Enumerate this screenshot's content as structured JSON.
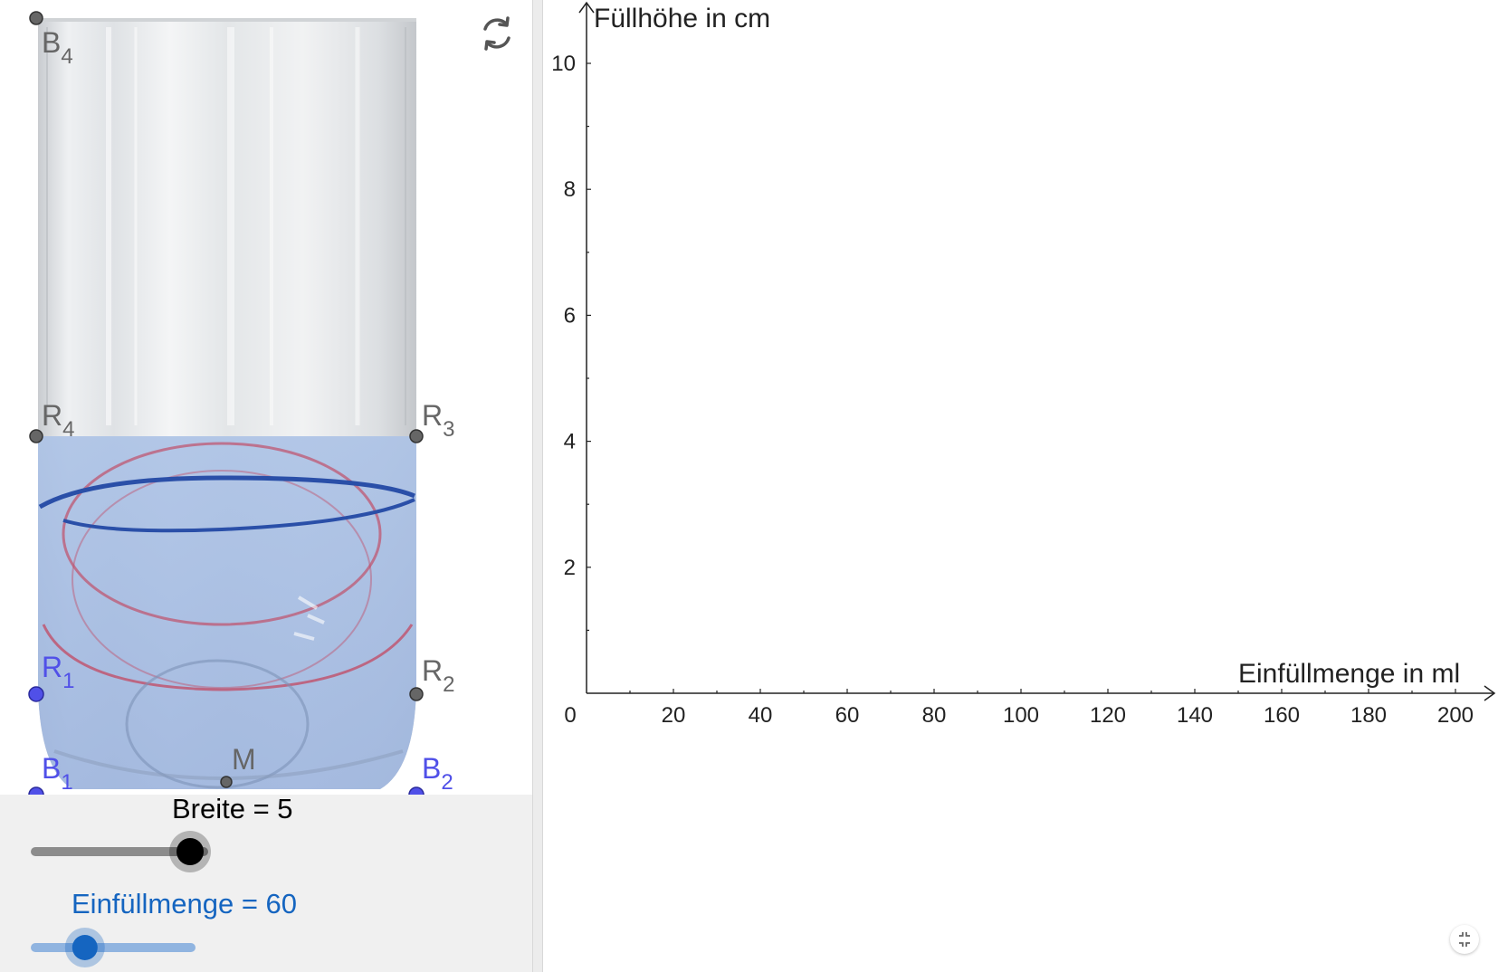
{
  "glass_view": {
    "fill_color": "#4f7fd6",
    "points": {
      "B4": {
        "letter": "B",
        "sub": "4"
      },
      "R4": {
        "letter": "R",
        "sub": "4"
      },
      "R3": {
        "letter": "R",
        "sub": "3"
      },
      "R1": {
        "letter": "R",
        "sub": "1"
      },
      "R2": {
        "letter": "R",
        "sub": "2"
      },
      "B1": {
        "letter": "B",
        "sub": "1"
      },
      "B2": {
        "letter": "B",
        "sub": "2"
      },
      "M": {
        "letter": "M",
        "sub": ""
      }
    },
    "reset_icon": "refresh-icon"
  },
  "sliders": {
    "breite": {
      "label": "Breite = 5",
      "value": 5,
      "min": 0,
      "max": 5,
      "color": "#000000"
    },
    "einfuellmenge": {
      "label": "Einfüllmenge = 60",
      "value": 60,
      "min": 0,
      "max": 200,
      "color": "#1565c0"
    }
  },
  "chart_data": {
    "type": "line",
    "xlabel": "Einfüllmenge in ml",
    "ylabel": "Füllhöhe in cm",
    "x_ticks": [
      "0",
      "20",
      "40",
      "60",
      "80",
      "100",
      "120",
      "140",
      "160",
      "180",
      "200"
    ],
    "y_ticks": [
      "2",
      "4",
      "6",
      "8",
      "10"
    ],
    "xlim": [
      0,
      210
    ],
    "ylim": [
      0,
      10.8
    ],
    "grid": false,
    "series": []
  },
  "controls": {
    "collapse_icon": "collapse-icon"
  }
}
